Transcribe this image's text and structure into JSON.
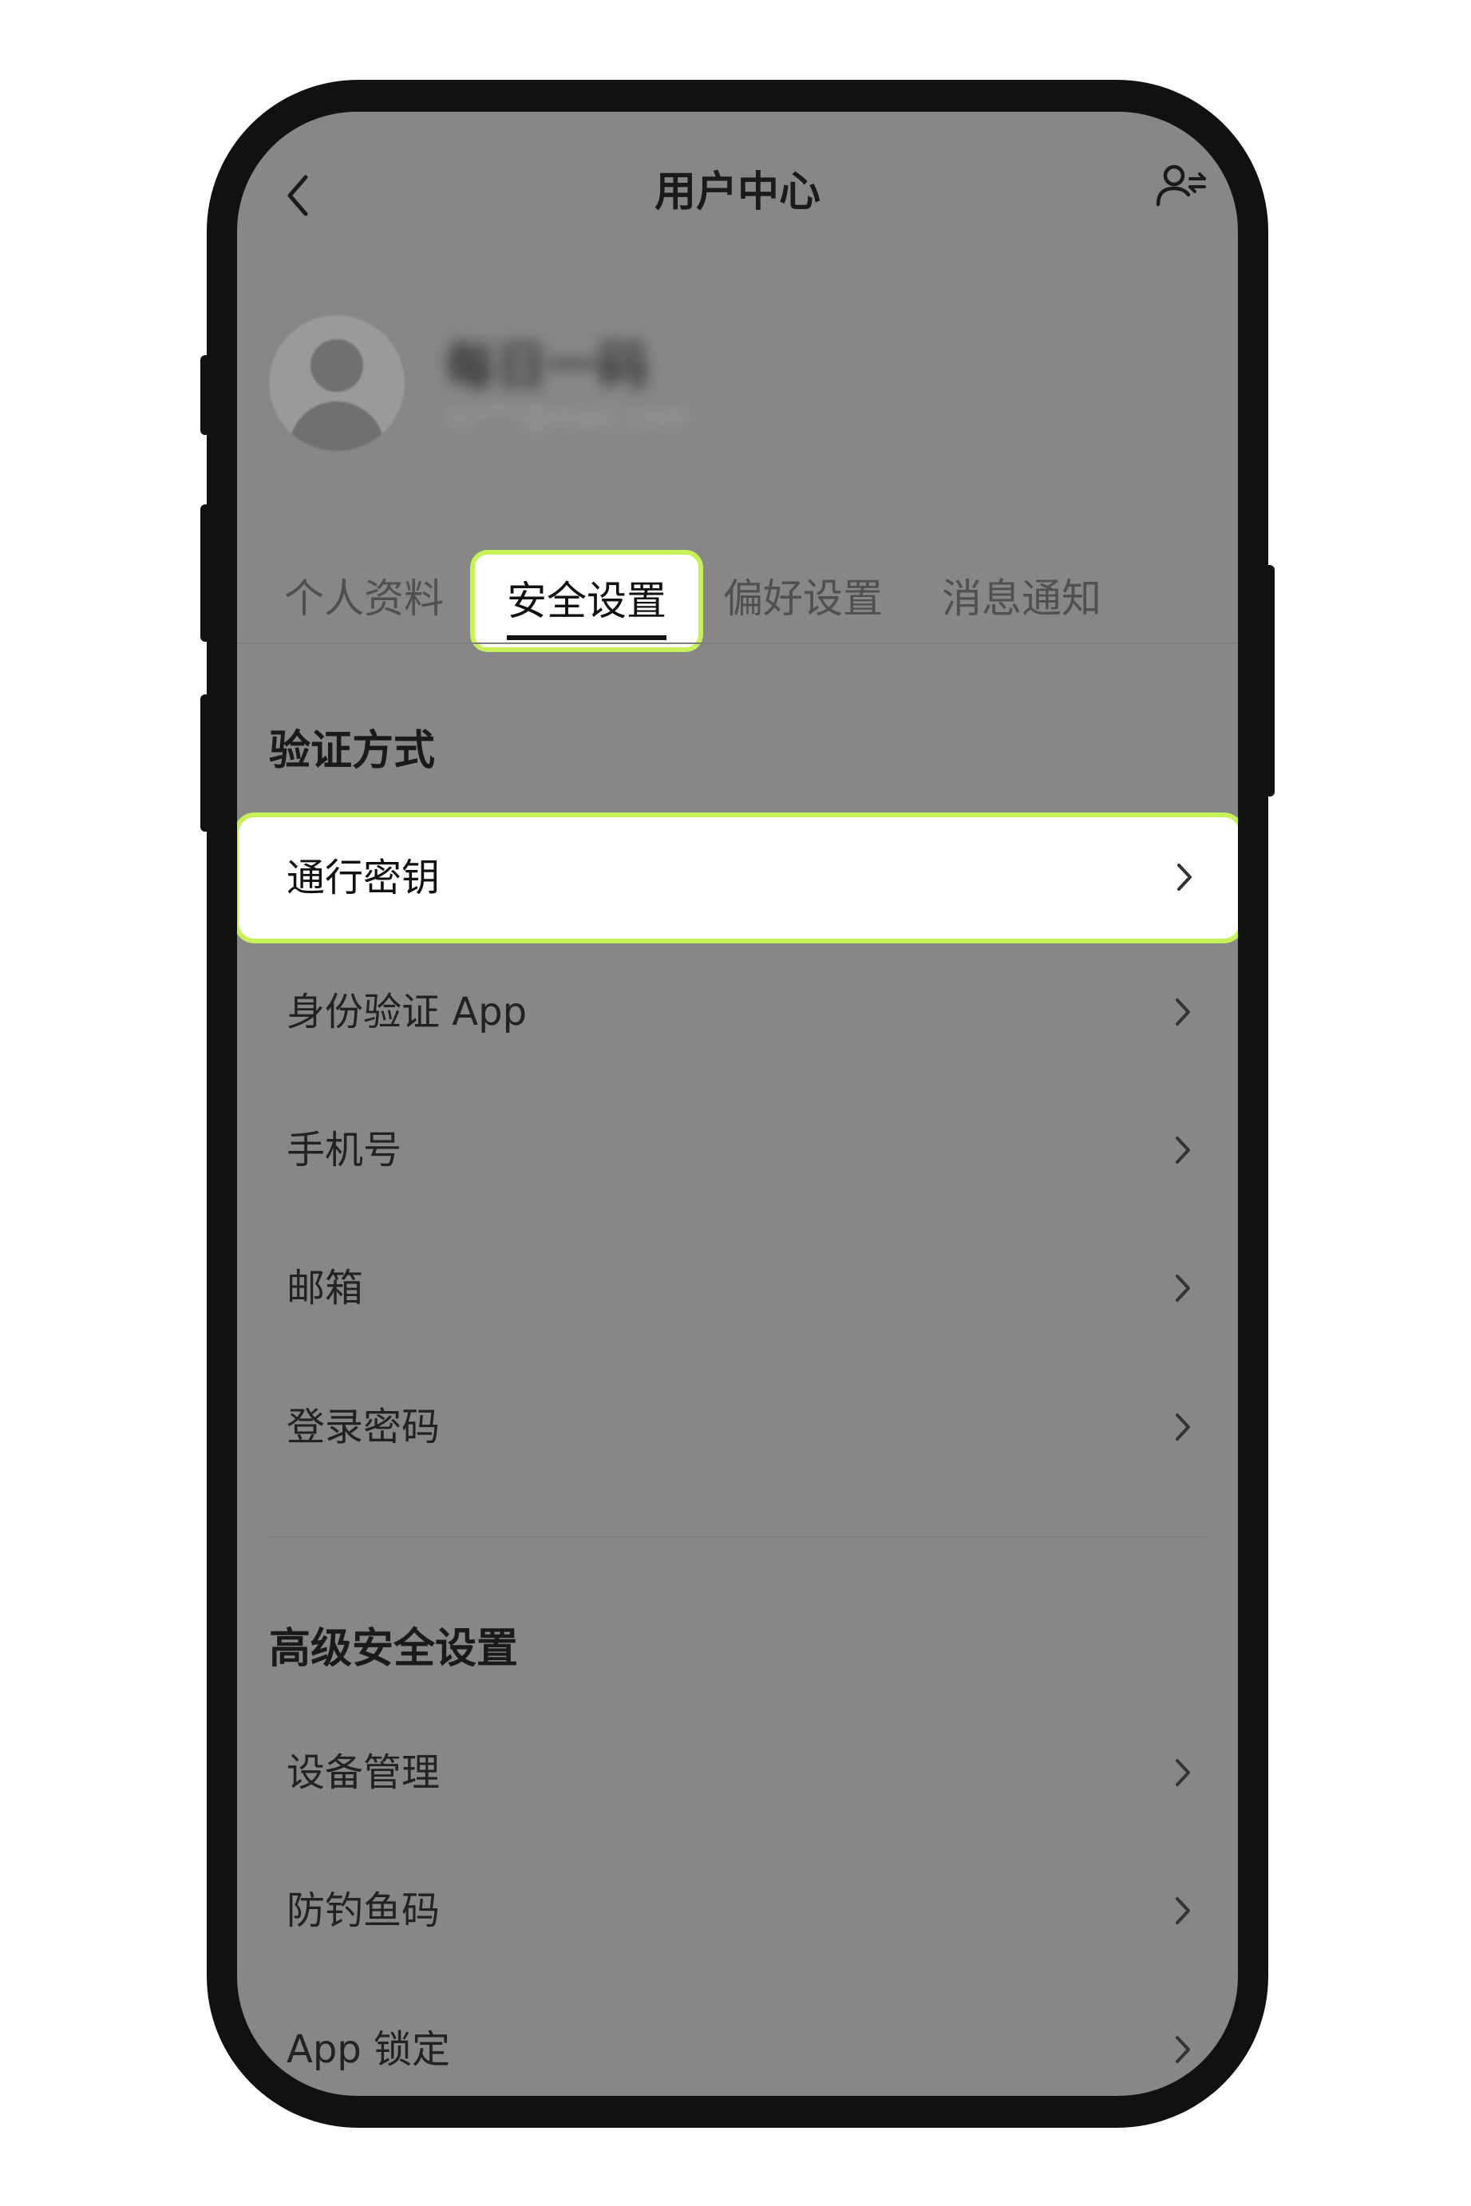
{
  "header": {
    "title": "用户中心"
  },
  "profile": {
    "name": "每日一码",
    "email": "m***@mail.com"
  },
  "tabs": [
    {
      "label": "个人资料",
      "active": false
    },
    {
      "label": "安全设置",
      "active": true
    },
    {
      "label": "偏好设置",
      "active": false
    },
    {
      "label": "消息通知",
      "active": false
    }
  ],
  "verification": {
    "title": "验证方式",
    "items": [
      {
        "label": "通行密钥",
        "highlighted": true
      },
      {
        "label": "身份验证 App"
      },
      {
        "label": "手机号"
      },
      {
        "label": "邮箱"
      },
      {
        "label": "登录密码"
      }
    ]
  },
  "advanced": {
    "title": "高级安全设置",
    "items": [
      {
        "label": "设备管理"
      },
      {
        "label": "防钓鱼码"
      },
      {
        "label": "App 锁定"
      }
    ]
  },
  "icons": {
    "back": "chevron-left-icon",
    "switch_user": "switch-user-icon",
    "row": "chevron-right-icon"
  },
  "colors": {
    "highlight_border": "#c6f15a",
    "overlay": "#878787"
  }
}
